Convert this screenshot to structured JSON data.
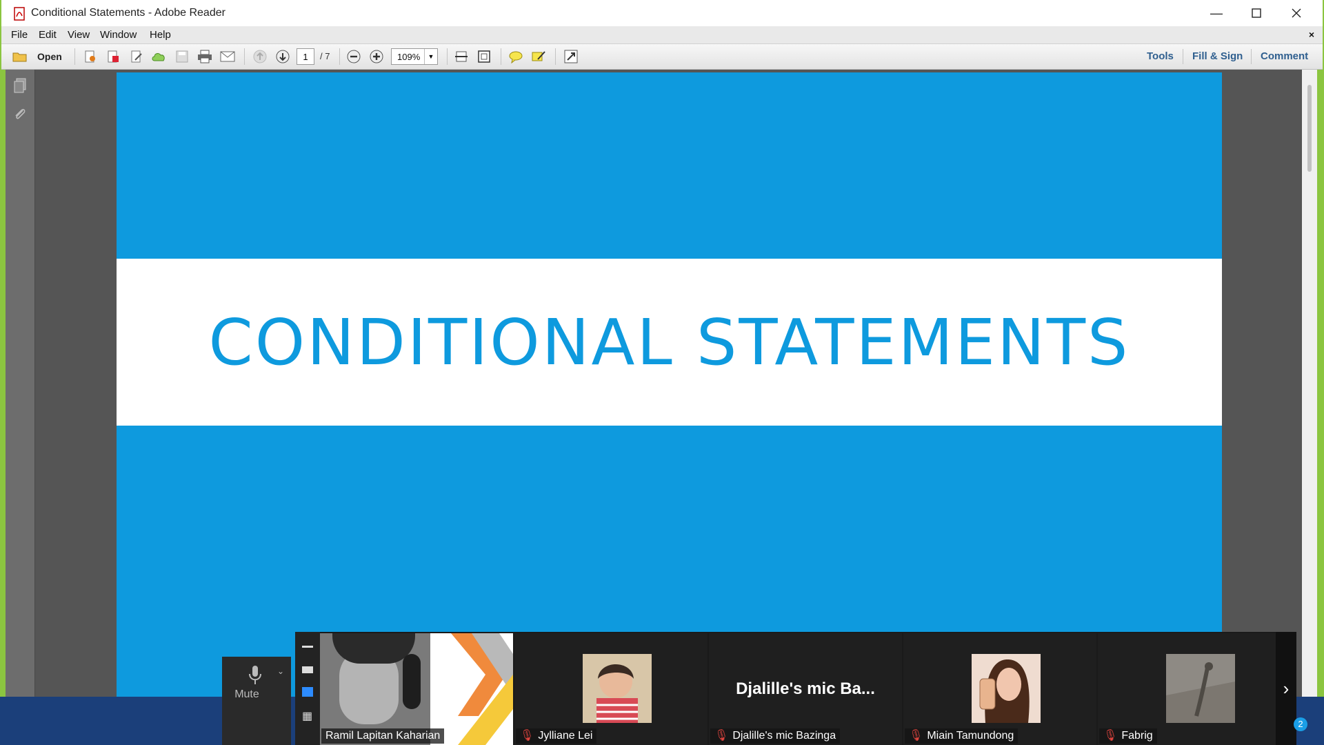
{
  "window": {
    "title": "Conditional Statements - Adobe Reader",
    "controls": [
      "minimize-icon",
      "maximize-icon",
      "close-icon"
    ]
  },
  "menu": {
    "items": [
      "File",
      "Edit",
      "View",
      "Window",
      "Help"
    ],
    "close_label": "×"
  },
  "toolbar": {
    "open_label": "Open",
    "page_current": "1",
    "page_total": "/ 7",
    "zoom": "109%",
    "tools_label": "Tools",
    "fill_sign_label": "Fill & Sign",
    "comment_label": "Comment"
  },
  "document": {
    "slide_title": "CONDITIONAL STATEMENTS",
    "colors": {
      "slide_bg": "#0e9ade",
      "band": "#ffffff",
      "title": "#0e9ade"
    }
  },
  "meeting": {
    "mute_label": "Mute",
    "participants": [
      {
        "name": "Ramil Lapitan Kaharian",
        "muted": false
      },
      {
        "name": "Jylliane Lei",
        "muted": true
      },
      {
        "name": "Djalille's mic Bazinga",
        "muted": true,
        "display": "Djalille's  mic  Ba..."
      },
      {
        "name": "Miain Tamundong",
        "muted": true
      },
      {
        "name": "Fabrig",
        "muted": true
      }
    ],
    "notification_count": "2"
  }
}
